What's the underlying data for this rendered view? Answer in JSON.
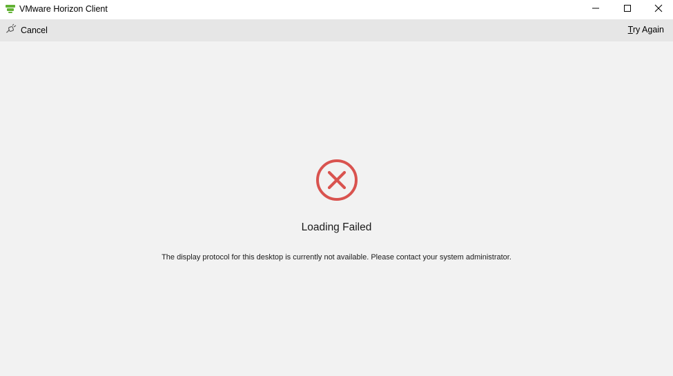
{
  "window": {
    "title": "VMware Horizon Client",
    "brand_color": "#62b234"
  },
  "toolbar": {
    "cancel_label": "Cancel",
    "try_again_label_mnemonic": "T",
    "try_again_label_rest": "ry Again"
  },
  "status": {
    "title": "Loading Failed",
    "message": "The display protocol for this desktop is currently not available. Please contact your system administrator.",
    "error_color": "#d9534f",
    "icon": "error-x-circle-icon"
  },
  "icons": {
    "app": "vmware-horizon-icon",
    "cancel": "disconnect-plug-icon",
    "minimize": "minimize-icon",
    "maximize": "maximize-icon",
    "close": "close-icon"
  }
}
